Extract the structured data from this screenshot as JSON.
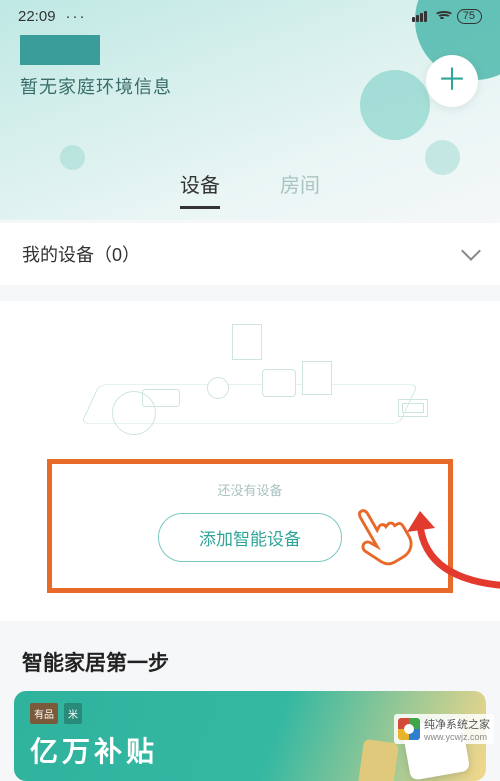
{
  "status_bar": {
    "time": "22:09",
    "menu_dots": "···",
    "battery": "75"
  },
  "header": {
    "env_info": "暂无家庭环境信息"
  },
  "tabs": {
    "devices": "设备",
    "rooms": "房间",
    "active": "devices"
  },
  "my_devices": {
    "label": "我的设备（0）"
  },
  "empty_state": {
    "no_device_text": "还没有设备",
    "add_button_label": "添加智能设备"
  },
  "smart_home": {
    "step_title": "智能家居第一步"
  },
  "promo": {
    "badges": [
      "有品",
      "米"
    ],
    "title": "亿万补贴"
  },
  "watermark": {
    "text": "纯净系统之家",
    "url": "www.ycwjz.com"
  }
}
